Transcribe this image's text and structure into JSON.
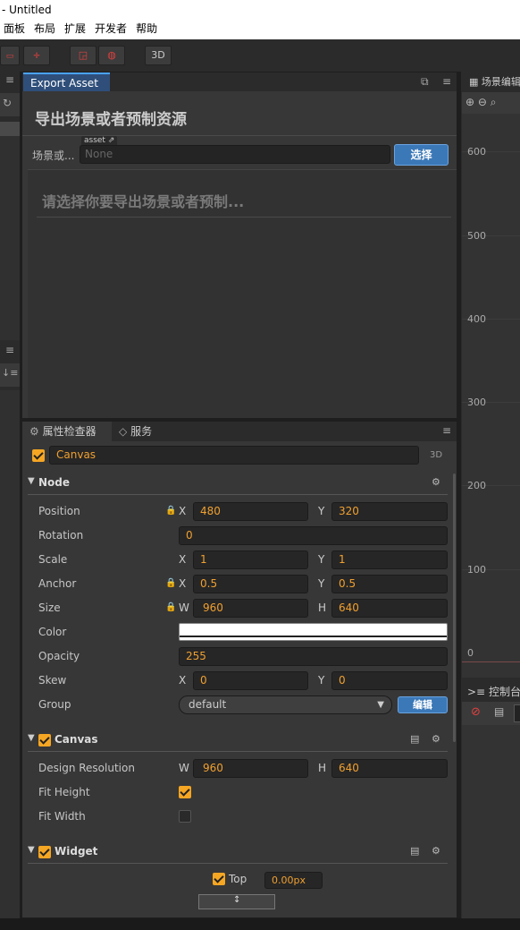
{
  "window": {
    "title": "- Untitled"
  },
  "menu": [
    "面板",
    "布局",
    "扩展",
    "开发者",
    "帮助"
  ],
  "toolbar": {
    "btn_3d": "3D"
  },
  "export_panel": {
    "tab": "Export Asset",
    "heading": "导出场景或者预制资源",
    "row_label": "场景或...",
    "asset_tag": "asset",
    "asset_value": "None",
    "select_button": "选择",
    "hint": "请选择你要导出场景或者预制..."
  },
  "inspector": {
    "tab_inspector": "属性检查器",
    "tab_service": "服务",
    "node_name": "Canvas",
    "node_enabled": true,
    "badge_3d": "3D",
    "node_section": "Node",
    "props": {
      "position": {
        "label": "Position",
        "x": "480",
        "y": "320"
      },
      "rotation": {
        "label": "Rotation",
        "value": "0"
      },
      "scale": {
        "label": "Scale",
        "x": "1",
        "y": "1"
      },
      "anchor": {
        "label": "Anchor",
        "x": "0.5",
        "y": "0.5"
      },
      "size": {
        "label": "Size",
        "w": "960",
        "h": "640"
      },
      "color": {
        "label": "Color",
        "value": "#ffffff"
      },
      "opacity": {
        "label": "Opacity",
        "value": "255"
      },
      "skew": {
        "label": "Skew",
        "x": "0",
        "y": "0"
      },
      "group": {
        "label": "Group",
        "value": "default",
        "edit_button": "编辑"
      }
    },
    "axis": {
      "x": "X",
      "y": "Y",
      "w": "W",
      "h": "H"
    },
    "canvas_section": {
      "title": "Canvas",
      "enabled": true,
      "design_resolution": {
        "label": "Design Resolution",
        "w": "960",
        "h": "640"
      },
      "fit_height": {
        "label": "Fit Height",
        "checked": true
      },
      "fit_width": {
        "label": "Fit Width",
        "checked": false
      }
    },
    "widget_section": {
      "title": "Widget",
      "enabled": true,
      "top": {
        "label": "Top",
        "checked": true,
        "value": "0.00px"
      }
    }
  },
  "scene_panel": {
    "tab": "场景编辑器",
    "y_ticks": [
      "600",
      "500",
      "400",
      "300",
      "200",
      "100",
      "0"
    ]
  },
  "console_panel": {
    "tab": "控制台"
  },
  "colors": {
    "accent": "#f5a623",
    "tab_active": "#2f4f7a",
    "select_button": "#3b78b8"
  }
}
